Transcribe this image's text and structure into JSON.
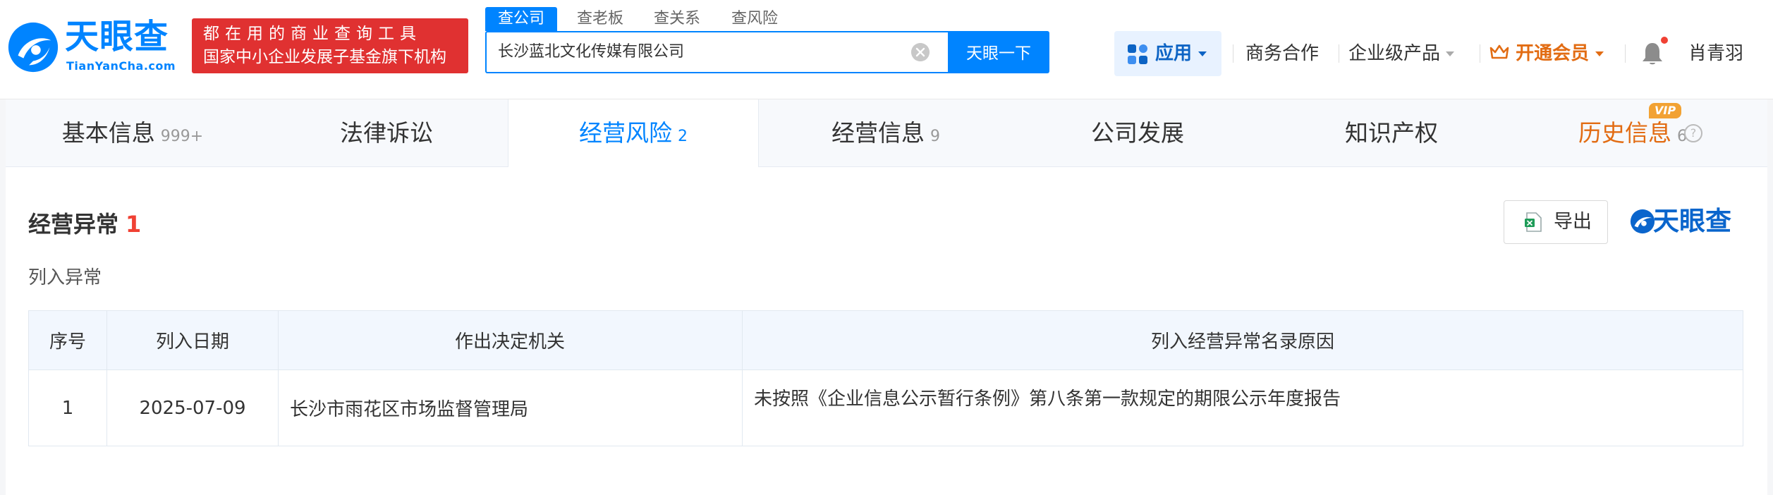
{
  "header": {
    "logo_cn": "天眼查",
    "logo_en": "TianYanCha.com",
    "banner_line1": "都在用的商业查询工具",
    "banner_line2": "国家中小企业发展子基金旗下机构",
    "search_tabs": [
      "查公司",
      "查老板",
      "查关系",
      "查风险"
    ],
    "search_value": "长沙蓝北文化传媒有限公司",
    "search_button": "天眼一下",
    "nav": {
      "apps": "应用",
      "business": "商务合作",
      "enterprise": "企业级产品",
      "vip": "开通会员",
      "user": "肖青羽"
    }
  },
  "tabs": [
    {
      "label": "基本信息",
      "count": "999+"
    },
    {
      "label": "法律诉讼",
      "count": ""
    },
    {
      "label": "经营风险",
      "count": "2"
    },
    {
      "label": "经营信息",
      "count": "9"
    },
    {
      "label": "公司发展",
      "count": ""
    },
    {
      "label": "知识产权",
      "count": ""
    },
    {
      "label": "历史信息",
      "count": "6"
    }
  ],
  "vip_badge": "VIP",
  "help_icon": "?",
  "section": {
    "title": "经营异常",
    "count": "1",
    "subtitle": "列入异常",
    "export_label": "导出",
    "watermark": "天眼查"
  },
  "table": {
    "headers": [
      "序号",
      "列入日期",
      "作出决定机关",
      "列入经营异常名录原因"
    ],
    "rows": [
      [
        "1",
        "2025-07-09",
        "长沙市雨花区市场监督管理局",
        "未按照《企业信息公示暂行条例》第八条第一款规定的期限公示年度报告"
      ]
    ]
  },
  "colors": {
    "brand_blue": "#0084ff",
    "banner_red": "#e03131",
    "vip_orange": "#e26c13",
    "count_red": "#f04134"
  }
}
